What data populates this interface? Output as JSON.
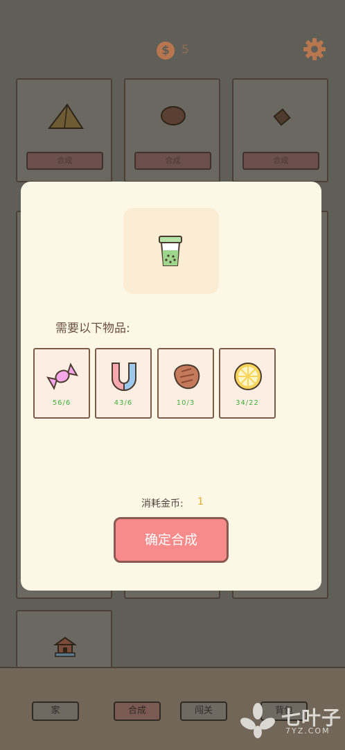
{
  "header": {
    "coin_symbol": "$",
    "coin_count": "5"
  },
  "grid": {
    "items": [
      {
        "icon": "sandwich-icon",
        "button_label": "合成"
      },
      {
        "icon": "steak-icon",
        "button_label": "合成"
      },
      {
        "icon": "candy-icon",
        "button_label": "合成"
      }
    ],
    "bottom_item_icon": "house-icon"
  },
  "modal": {
    "product_icon": "bubble-tea-icon",
    "needs_label": "需要以下物品:",
    "requirements": [
      {
        "icon": "candy-icon",
        "qty": "56/6"
      },
      {
        "icon": "magnet-icon",
        "qty": "43/6"
      },
      {
        "icon": "steak-icon",
        "qty": "10/3"
      },
      {
        "icon": "lemon-slice-icon",
        "qty": "34/22"
      }
    ],
    "cost_label": "消耗金币:",
    "cost_value": "1",
    "confirm_label": "确定合成"
  },
  "nav": {
    "home": "家",
    "craft": "合成",
    "levels": "闯关",
    "bag": "背包"
  },
  "watermark": {
    "title": "七叶子",
    "sub": "7YZ.COM"
  },
  "colors": {
    "accent": "#f78b8b",
    "modal_bg": "#fdf8e6",
    "qty_green": "#3fae3a",
    "cost_gold": "#e2a91c"
  }
}
